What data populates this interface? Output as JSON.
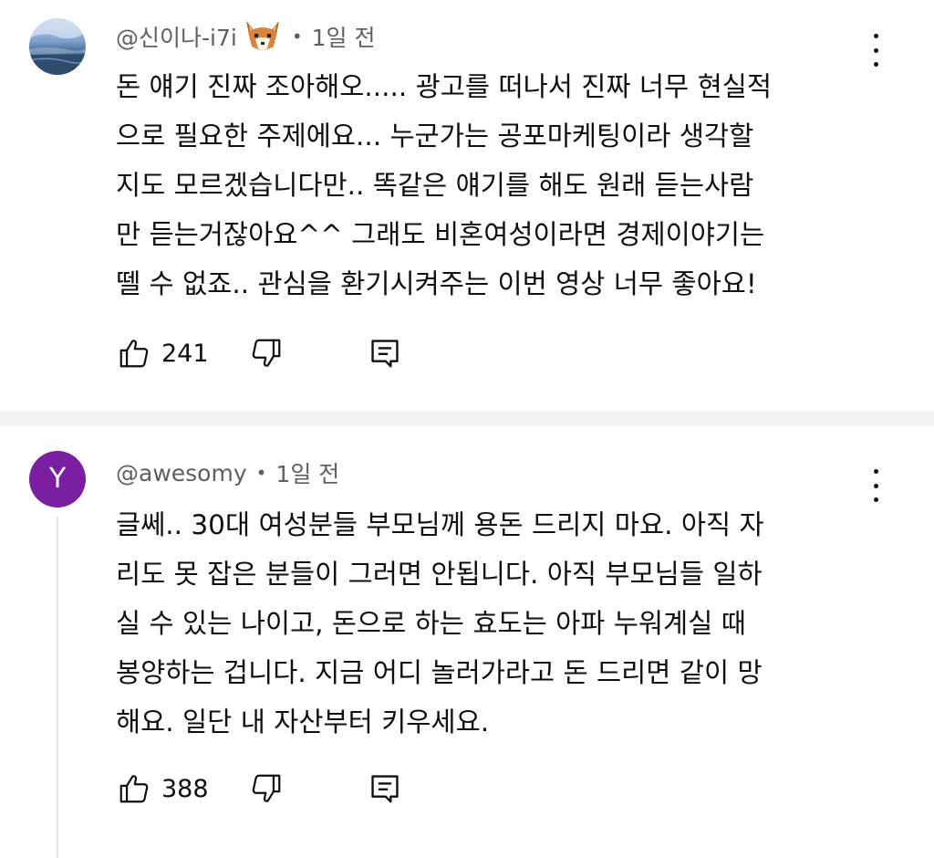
{
  "comments": [
    {
      "author": "@신이나-i7i",
      "time": "1일 전",
      "lines": [
        "돈 얘기 진짜 조아해오..... 광고를 떠나서 진짜 너무 현실적",
        "으로 필요한 주제에요... 누군가는 공포마케팅이라 생각할",
        "지도 모르겠습니다만.. 똑같은 얘기를 해도 원래 듣는사람",
        "만 듣는거잖아요^^ 그래도 비혼여성이라면 경제이야기는",
        "뗄 수 없죠.. 관심을 환기시켜주는 이번 영상 너무 좋아요!"
      ],
      "likes": "241",
      "avatar_icon": "landscape-photo"
    },
    {
      "author": "@awesomy",
      "time": "1일 전",
      "avatar_letter": "Y",
      "avatar_color": "#7b1fa2",
      "lines": [
        "글쎄.. 30대 여성분들 부모님께 용돈 드리지 마요. 아직 자",
        "리도 못 잡은 분들이 그러면 안됩니다. 아직 부모님들 일하",
        "실 수 있는 나이고, 돈으로 하는 효도는 아파 누워계실 때",
        "봉양하는 겁니다. 지금 어디 놀러가라고 돈 드리면 같이 망",
        "해요. 일단 내 자산부터 키우세요."
      ],
      "likes": "388"
    }
  ],
  "separator": "•",
  "colors": {
    "text": "#0f0f0f",
    "meta": "#606060",
    "divider": "#f2f2f2"
  }
}
